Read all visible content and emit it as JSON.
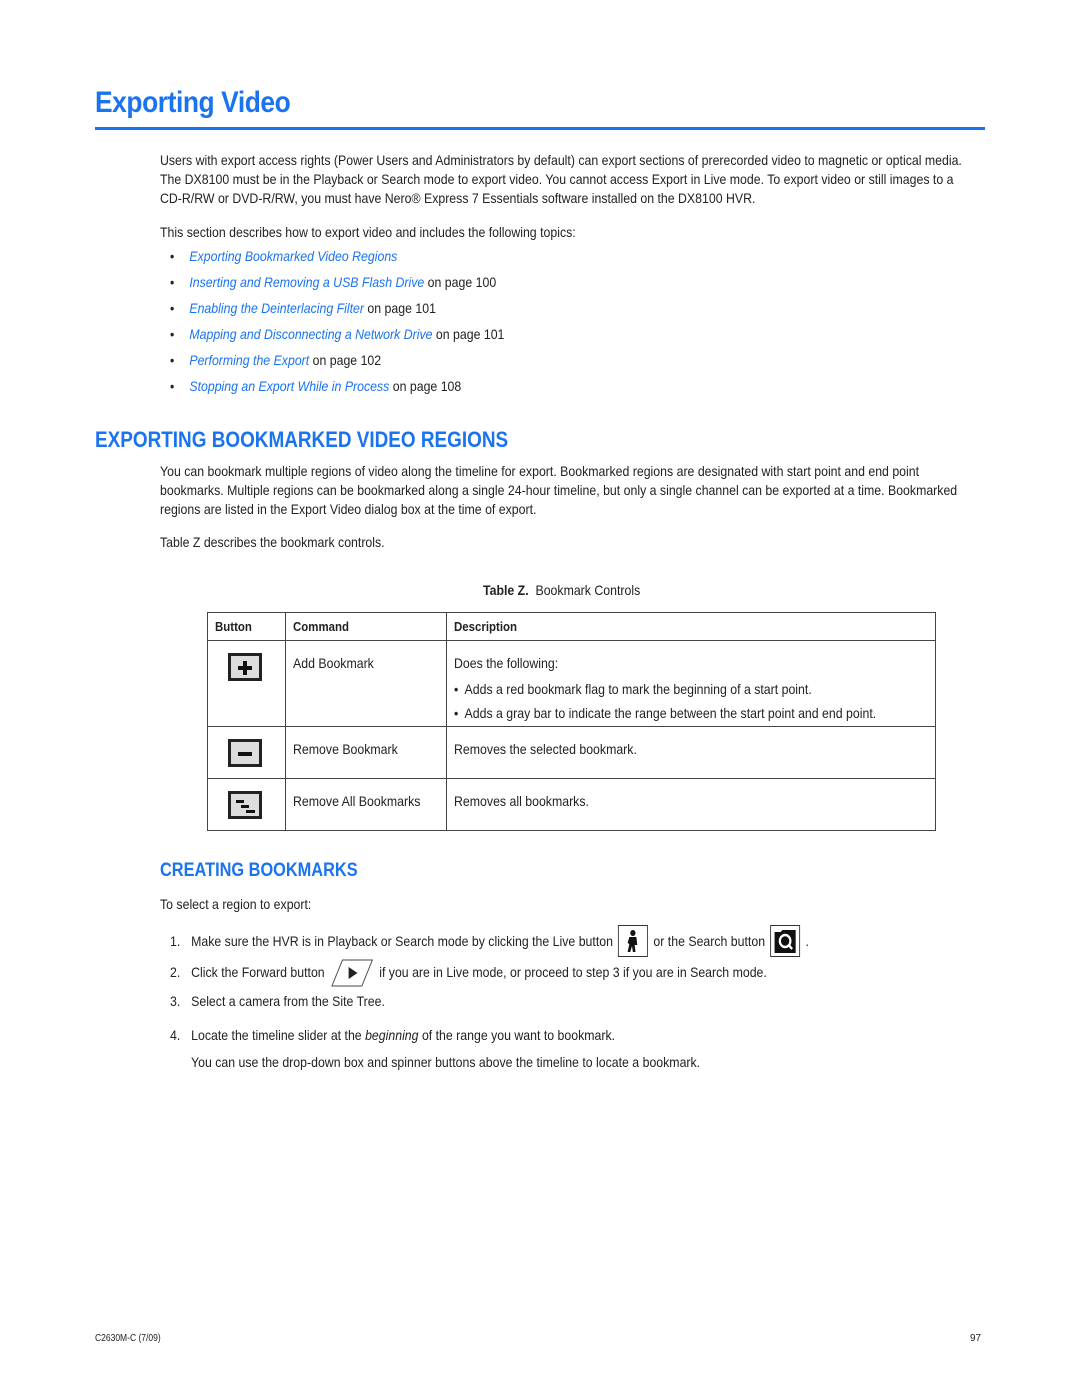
{
  "page": {
    "title": "Exporting Video",
    "intro": "Users with export access rights (Power Users and Administrators by default) can export sections of prerecorded video to magnetic or optical media. The DX8100 must be in the Playback or Search mode to export video. You cannot access Export in Live mode. To export video or still images to a CD-R/RW or DVD-R/RW, you must have Nero® Express 7 Essentials software installed on the DX8100 HVR.",
    "topics_intro": "This section describes how to export video and includes the following topics:",
    "topics": [
      {
        "link": "Exporting Bookmarked Video Regions",
        "suffix": ""
      },
      {
        "link": "Inserting and Removing a USB Flash Drive",
        "suffix": " on page 100"
      },
      {
        "link": "Enabling the Deinterlacing Filter",
        "suffix": " on page 101"
      },
      {
        "link": "Mapping and Disconnecting a Network Drive",
        "suffix": " on page 101"
      },
      {
        "link": "Performing the Export",
        "suffix": " on page 102"
      },
      {
        "link": "Stopping an Export While in Process",
        "suffix": " on page 108"
      }
    ]
  },
  "section": {
    "heading": "EXPORTING BOOKMARKED VIDEO REGIONS",
    "para": "You can bookmark multiple regions of video along the timeline for export. Bookmarked regions are designated with start point and end point bookmarks. Multiple regions can be bookmarked along a single 24-hour timeline, but only a single channel can be exported at a time. Bookmarked regions are listed in the Export Video dialog box at the time of export.",
    "table_ref": "Table Z describes the bookmark controls."
  },
  "table": {
    "caption_label": "Table Z.",
    "caption_text": "Bookmark Controls",
    "headers": [
      "Button",
      "Command",
      "Description"
    ],
    "rows": [
      {
        "icon": "add-bookmark-icon",
        "command": "Add Bookmark",
        "description": "Does the following:",
        "bullets": [
          "Adds a red bookmark flag to mark the beginning of a start point.",
          "Adds a gray bar to indicate the range between the start point and end point."
        ]
      },
      {
        "icon": "remove-bookmark-icon",
        "command": "Remove Bookmark",
        "description": "Removes the selected bookmark.",
        "bullets": []
      },
      {
        "icon": "remove-all-bookmarks-icon",
        "command": "Remove All Bookmarks",
        "description": "Removes all bookmarks.",
        "bullets": []
      }
    ]
  },
  "subsection": {
    "heading": "CREATING BOOKMARKS",
    "intro": "To select a region to export:",
    "steps": [
      {
        "num": "1.",
        "a": "Make sure the HVR is in Playback or Search mode by clicking the Live button",
        "b": "or the Search button",
        "c": "."
      },
      {
        "num": "2.",
        "a": "Click the Forward button",
        "b": "if you are in Live mode, or proceed to step 3 if you are in Search mode."
      },
      {
        "num": "3.",
        "a": "Select a camera from the Site Tree."
      },
      {
        "num": "4.",
        "a": "Locate the timeline slider at the ",
        "em": "beginning",
        "b": " of the range you want to bookmark."
      }
    ],
    "step4_note": "You can use the drop-down box and spinner buttons above the timeline to locate a bookmark."
  },
  "footer": {
    "doc_id": "C2630M-C (7/09)",
    "page_number": "97"
  },
  "colors": {
    "accent": "#1a73f0"
  }
}
